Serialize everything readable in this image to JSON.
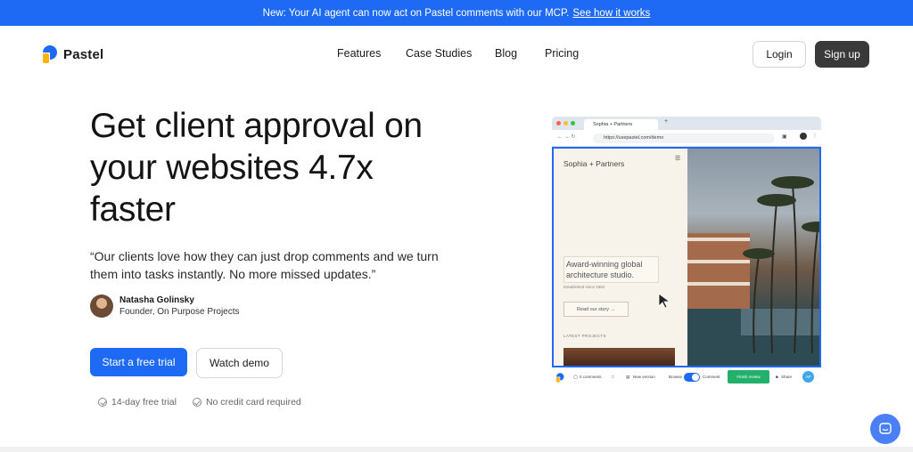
{
  "announcement": {
    "text": "New: Your AI agent can now act on Pastel comments with our MCP.",
    "link": "See how it works"
  },
  "nav": {
    "brand": "Pastel",
    "links": [
      "Features",
      "Case Studies",
      "Blog",
      "Pricing"
    ],
    "login": "Login",
    "signup": "Sign up"
  },
  "hero": {
    "title_lines": [
      "Get client approval on",
      "your websites 4.7x",
      "faster"
    ],
    "quote": "“Our clients love how they can just drop comments and we turn them into tasks instantly. No more missed updates.”",
    "author_name": "Natasha Golinsky",
    "author_role": "Founder, On Purpose Projects",
    "cta_primary": "Start a free trial",
    "cta_secondary": "Watch demo",
    "perks": [
      "14-day free trial",
      "No credit card required"
    ]
  },
  "mockup": {
    "tab_title": "Sophia + Partners",
    "url": "https://usepastel.com/demo",
    "site_brand": "Sophia + Partners",
    "headline": "Award-winning global architecture studio.",
    "established": "Established since 1962",
    "story_button": "Read our story →",
    "latest": "LATEST PROJECTS",
    "toolbar": {
      "comments": "0 comments",
      "new_version": "New version",
      "browse": "Browse",
      "comment": "Comment",
      "finish": "Finish review",
      "share": "Share",
      "avatar": "AP"
    }
  },
  "colors": {
    "brand_blue": "#1e6af5",
    "signup_bg": "#3a3a3a",
    "finish_green": "#22b06a"
  }
}
